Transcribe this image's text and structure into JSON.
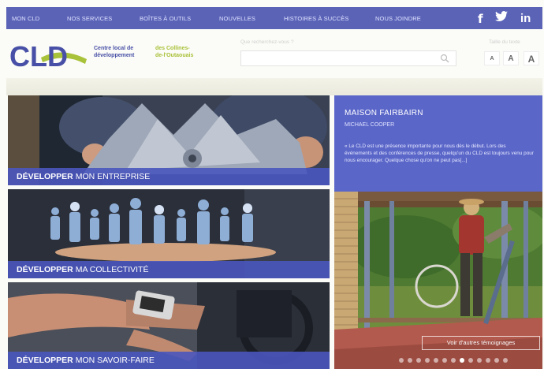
{
  "nav": {
    "items": [
      "MON CLD",
      "NOS SERVICES",
      "BOÎTES À OUTILS",
      "NOUVELLES",
      "HISTOIRES À SUCCÈS",
      "NOUS JOINDRE"
    ]
  },
  "social": {
    "facebook": "f",
    "twitter": "t",
    "linkedin": "in"
  },
  "logo": {
    "mark": "CLD",
    "line1": "Centre local de",
    "line2": "développement",
    "line3": "des Collines-",
    "line4": "de-l'Outaouais"
  },
  "search": {
    "label": "Que recherchez-vous ?",
    "placeholder": ""
  },
  "textsize": {
    "label": "Taille du texte",
    "buttons": [
      "A",
      "A",
      "A"
    ]
  },
  "tiles": [
    {
      "bold": "DÉVELOPPER",
      "rest": " MON ENTREPRISE"
    },
    {
      "bold": "DÉVELOPPER",
      "rest": " MA COLLECTIVITÉ"
    },
    {
      "bold": "DÉVELOPPER",
      "rest": " MON SAVOIR-FAIRE"
    }
  ],
  "feature": {
    "title": "MAISON FAIRBAIRN",
    "author": "MICHAEL COOPER",
    "body": "« Le CLD est une présence importante pour nous dès le début. Lors des événements et des conférences de presse, quelqu'un du CLD est toujours venu pour nous encourager. Quelque chose qu'on ne peut pas[...]"
  },
  "slider": {
    "more_label": "Voir d'autres témoignages",
    "dot_count": 13,
    "active_dot": 7
  },
  "colors": {
    "nav": "#5b63b7",
    "accent_blue": "#4750a6",
    "accent_green": "#a8c23a",
    "feature_bg": "#5a66c8"
  }
}
